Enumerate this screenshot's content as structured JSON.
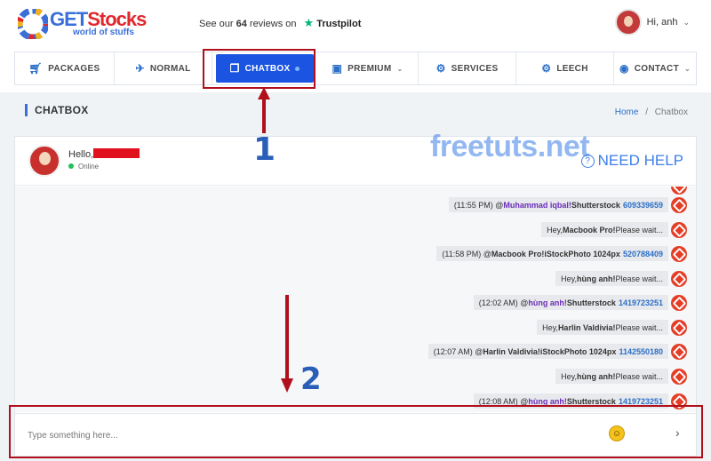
{
  "header": {
    "brand_get": "GET",
    "brand_stocks": "Stocks",
    "tagline": "world of stuffs",
    "reviews_prefix": "See our",
    "reviews_count": "64",
    "reviews_suffix": "reviews on",
    "trustpilot": "Trustpilot",
    "greeting": "Hi, anh"
  },
  "nav": [
    {
      "label": "PACKAGES",
      "icon": "cart-icon"
    },
    {
      "label": "NORMAL",
      "icon": "satellite-icon"
    },
    {
      "label": "CHATBOX",
      "icon": "chat-icon"
    },
    {
      "label": "PREMIUM",
      "icon": "image-icon"
    },
    {
      "label": "SERVICES",
      "icon": "gear-icon"
    },
    {
      "label": "LEECH",
      "icon": "gear-icon"
    },
    {
      "label": "CONTACT",
      "icon": "person-icon"
    }
  ],
  "page": {
    "title": "CHATBOX",
    "breadcrumb_home": "Home",
    "breadcrumb_sep": "/",
    "breadcrumb_current": "Chatbox"
  },
  "annotations": {
    "step1": "1",
    "step2": "2"
  },
  "chat": {
    "hello": "Hello,",
    "status": "Online",
    "watermark": "freetuts.net",
    "need_help": "NEED HELP",
    "input_placeholder": "Type something here...",
    "messages": [
      {
        "time": "(11:55 PM) @",
        "user": "Muhammad iqbal!",
        "service": " Shutterstock",
        "id": "609339659"
      },
      {
        "pre": "Hey, ",
        "who": "Macbook Pro!",
        "post": " Please wait..."
      },
      {
        "time": "(11:58 PM) @",
        "user": "Macbook Pro!",
        "service": " iStockPhoto 1024px",
        "id": "520788409"
      },
      {
        "pre": "Hey, ",
        "who": "hùng anh!",
        "post": " Please wait..."
      },
      {
        "time": "(12:02 AM) @",
        "user": "hùng anh!",
        "service": " Shutterstock",
        "id": "1419723251"
      },
      {
        "pre": "Hey, ",
        "who": "Harlin Valdivia!",
        "post": " Please wait..."
      },
      {
        "time": "(12:07 AM) @",
        "user": "Harlin Valdivia!",
        "service": " iStockPhoto 1024px",
        "id": "1142550180"
      },
      {
        "pre": "Hey, ",
        "who": "hùng anh!",
        "post": " Please wait..."
      },
      {
        "time": "(12:08 AM) @",
        "user": "hùng anh!",
        "service": " Shutterstock",
        "id": "1419723251"
      }
    ]
  },
  "colors": {
    "accent": "#1a54e0",
    "highlight": "#b0101b",
    "bot": "#e53d25"
  }
}
